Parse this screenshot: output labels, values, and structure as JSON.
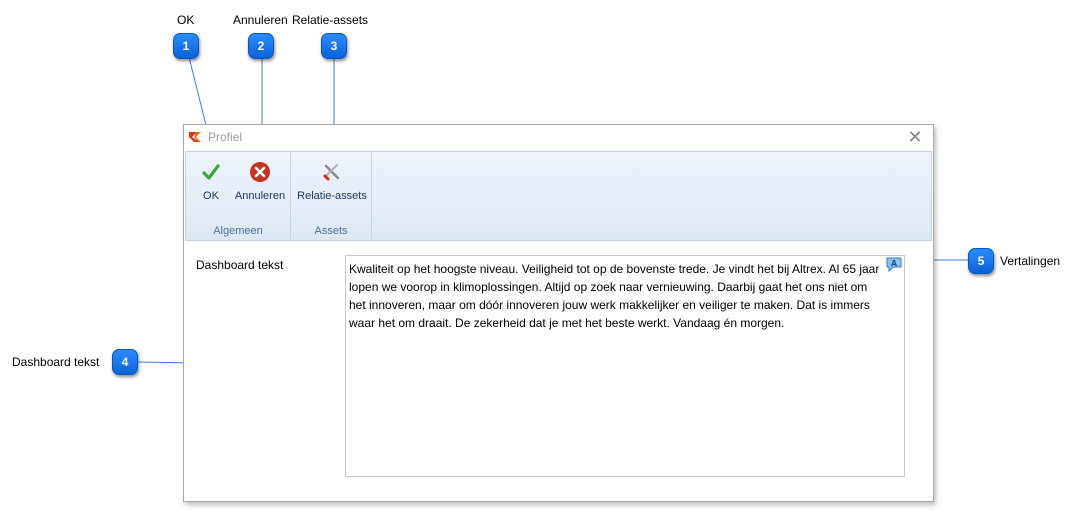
{
  "callouts": [
    {
      "number": "1",
      "label": "OK"
    },
    {
      "number": "2",
      "label": "Annuleren"
    },
    {
      "number": "3",
      "label": "Relatie-assets"
    },
    {
      "number": "4",
      "label": "Dashboard tekst"
    },
    {
      "number": "5",
      "label": "Vertalingen"
    }
  ],
  "window": {
    "title": "Profiel",
    "icon": "altrex-logo-icon",
    "close_icon": "close-icon"
  },
  "ribbon": {
    "groups": [
      {
        "label": "Algemeen",
        "buttons": [
          {
            "label": "OK",
            "icon": "checkmark-icon"
          },
          {
            "label": "Annuleren",
            "icon": "cancel-icon"
          }
        ]
      },
      {
        "label": "Assets",
        "buttons": [
          {
            "label": "Relatie-assets",
            "icon": "tools-icon"
          }
        ]
      }
    ]
  },
  "form": {
    "dashboard_label": "Dashboard tekst",
    "dashboard_text": "Kwaliteit op het hoogste niveau. Veiligheid tot op de bovenste trede. Je vindt het bij Altrex. Al 65 jaar lopen we voorop in klimoplossingen. Altijd op zoek naar vernieuwing. Daarbij gaat het ons niet om het innoveren, maar om dóór innoveren jouw werk makkelijker en veiliger te maken. Dat is immers waar het om draait. De zekerheid dat je met het beste werkt. Vandaag én morgen.",
    "translate_icon": "translate-icon"
  },
  "colors": {
    "badge": "#1a7cf0",
    "ribbon": "#dde7f4",
    "ok_green": "#3aa83a",
    "cancel_red": "#c8321e"
  }
}
